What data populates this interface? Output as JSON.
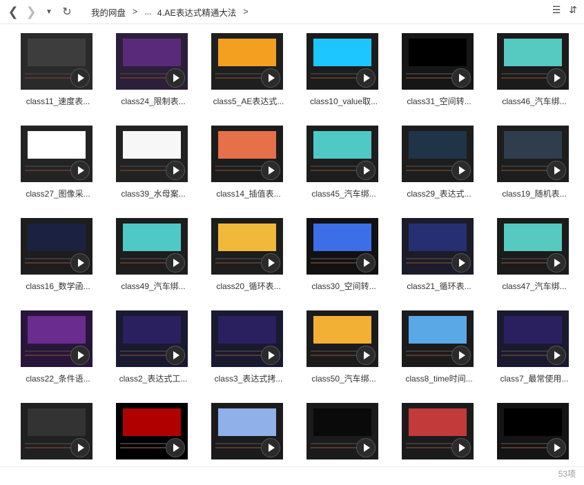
{
  "nav": {
    "back_icon": "arrow-left-icon",
    "forward_icon": "arrow-right-icon",
    "history_icon": "caret-down-icon",
    "refresh_icon": "refresh-icon"
  },
  "breadcrumb": {
    "root": "我的网盘",
    "ellipsis": "...",
    "current": "4.AE表达式精通大法",
    "sep": ">"
  },
  "toolbar": {
    "view_icon": "list-view-icon",
    "sort_icon": "sort-icon"
  },
  "items": [
    {
      "label": "class11_速度表...",
      "color": "#2a2a2a",
      "pane": "#3d3d3d"
    },
    {
      "label": "class24_限制表...",
      "color": "#2c1f3a",
      "pane": "#5a2a7a"
    },
    {
      "label": "class5_AE表达式...",
      "color": "#1f1f1f",
      "pane": "#f3a020"
    },
    {
      "label": "class10_value取...",
      "color": "#1c1c1c",
      "pane": "#1ec6ff"
    },
    {
      "label": "class31_空间转...",
      "color": "#161616",
      "pane": "#000000"
    },
    {
      "label": "class46_汽车绑...",
      "color": "#1b1b1b",
      "pane": "#56c9c1"
    },
    {
      "label": "class27_图像采...",
      "color": "#232323",
      "pane": "#ffffff"
    },
    {
      "label": "class39_水母案...",
      "color": "#222222",
      "pane": "#f7f7f7"
    },
    {
      "label": "class14_插值表...",
      "color": "#1c1c1c",
      "pane": "#e5704a"
    },
    {
      "label": "class45_汽车绑...",
      "color": "#1d1d1d",
      "pane": "#4ec9c6"
    },
    {
      "label": "class29_表达式...",
      "color": "#1d1d1d",
      "pane": "#203447"
    },
    {
      "label": "class19_随机表...",
      "color": "#1d1d1d",
      "pane": "#2f3d4c"
    },
    {
      "label": "class16_数学函...",
      "color": "#1d1d1d",
      "pane": "#1b2240"
    },
    {
      "label": "class49_汽车绑...",
      "color": "#1d1d1d",
      "pane": "#4ec9c6"
    },
    {
      "label": "class20_循环表...",
      "color": "#1d1d1d",
      "pane": "#f0b93a"
    },
    {
      "label": "class30_空间转...",
      "color": "#111111",
      "pane": "#3c6ee8"
    },
    {
      "label": "class21_循环表...",
      "color": "#1b1b2a",
      "pane": "#263070"
    },
    {
      "label": "class47_汽车绑...",
      "color": "#1b1b1b",
      "pane": "#56c9c1"
    },
    {
      "label": "class22_条件语...",
      "color": "#28163a",
      "pane": "#6a2c8e"
    },
    {
      "label": "class2_表达式工...",
      "color": "#191930",
      "pane": "#2a2060"
    },
    {
      "label": "class3_表达式拷...",
      "color": "#191930",
      "pane": "#2a2060"
    },
    {
      "label": "class50_汽车绑...",
      "color": "#1b1b1b",
      "pane": "#f2b035"
    },
    {
      "label": "class8_time时间...",
      "color": "#1b1b1b",
      "pane": "#5aa8e6"
    },
    {
      "label": "class7_最常使用...",
      "color": "#191930",
      "pane": "#2a2060"
    },
    {
      "label": "",
      "color": "#202020",
      "pane": "#333333"
    },
    {
      "label": "",
      "color": "#000000",
      "pane": "#b00000"
    },
    {
      "label": "",
      "color": "#1b1b1b",
      "pane": "#8fb0e8"
    },
    {
      "label": "",
      "color": "#1b1b1b",
      "pane": "#0a0a0a"
    },
    {
      "label": "",
      "color": "#1b1b1b",
      "pane": "#c33a3a"
    },
    {
      "label": "",
      "color": "#141414",
      "pane": "#000000"
    }
  ],
  "status": {
    "count": "53项"
  }
}
